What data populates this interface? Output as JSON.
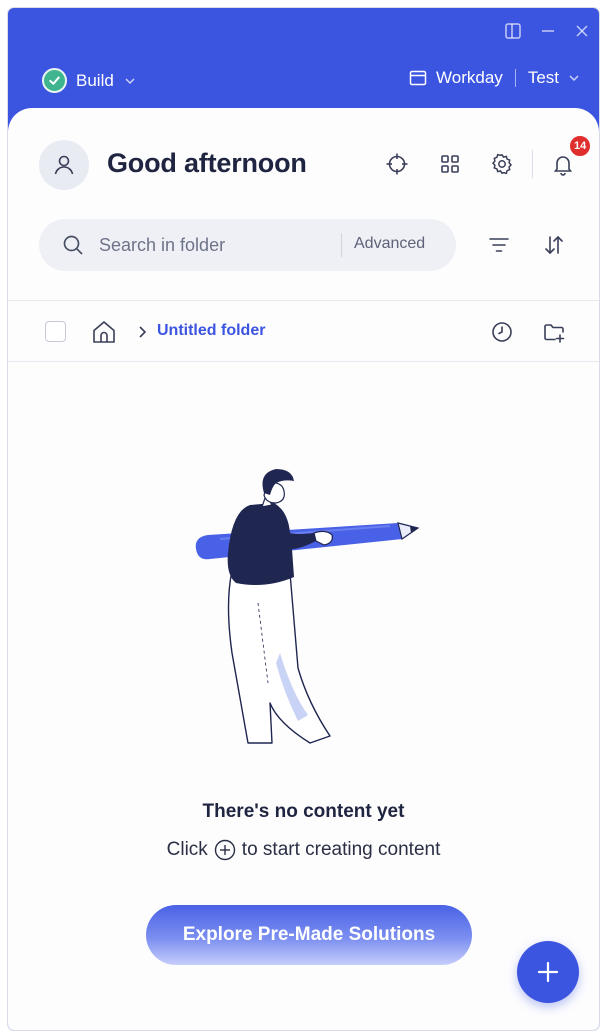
{
  "app": {
    "accent_color": "#3b55e0",
    "build_status_color": "#3fb58f"
  },
  "titlebar": {
    "icons": [
      "panel-toggle-icon",
      "minimize-icon",
      "close-icon"
    ]
  },
  "env_bar": {
    "build_label": "Build",
    "system_label": "Workday",
    "environment_label": "Test"
  },
  "header": {
    "greeting": "Good afternoon",
    "notification_count": "14",
    "icons": [
      "crosshair-icon",
      "grid-icon",
      "gear-icon",
      "bell-icon"
    ]
  },
  "search": {
    "placeholder": "Search in folder",
    "value": "",
    "advanced_label": "Advanced"
  },
  "breadcrumb": {
    "current_folder": "Untitled folder"
  },
  "empty_state": {
    "title": "There's no content yet",
    "subtitle_before": "Click",
    "subtitle_after": "to start creating content"
  },
  "actions": {
    "explore_label": "Explore Pre-Made Solutions"
  }
}
